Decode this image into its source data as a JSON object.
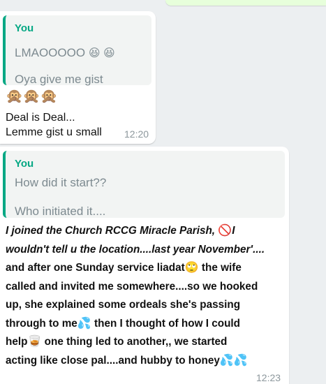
{
  "messages": [
    {
      "quote": {
        "author": "You",
        "line1": "LMAOOOOO",
        "line1_emoji": "😆 😆",
        "line2": "Oya give me gist"
      },
      "emoji_row": "🙊🙊🙊",
      "text_line1": "Deal is Deal...",
      "text_line2": "Lemme gist u small",
      "time": "12:20"
    },
    {
      "quote": {
        "author": "You",
        "line1": "How did it start??",
        "line2": "Who initiated it...."
      },
      "lines": [
        {
          "pre": "I joined the Church RCCG Miracle Parish, ",
          "emoji": "🚫",
          "post": "I"
        },
        {
          "pre": "wouldn't tell u the location....last year November'....",
          "emoji": "",
          "post": ""
        },
        {
          "pre": "and after one Sunday service liadat",
          "emoji": "🙄",
          "post": " the wife"
        },
        {
          "pre": "called and invited me somewhere....so we hooked",
          "emoji": "",
          "post": ""
        },
        {
          "pre": "up, she explained some ordeals she's passing",
          "emoji": "",
          "post": ""
        },
        {
          "pre": "through to me",
          "emoji": "💦",
          "post": "  then I thought of how I could"
        },
        {
          "pre": "help",
          "emoji": "🥃",
          "post": "  one thing led to another,, we started"
        },
        {
          "pre": "acting like close pal....and hubby to honey",
          "emoji": "💦💦",
          "post": ""
        }
      ],
      "time": "12:23"
    }
  ],
  "colors": {
    "background": "#eceff1",
    "quote_accent": "#06a884",
    "outgoing_bubble": "#e7ffdb"
  }
}
